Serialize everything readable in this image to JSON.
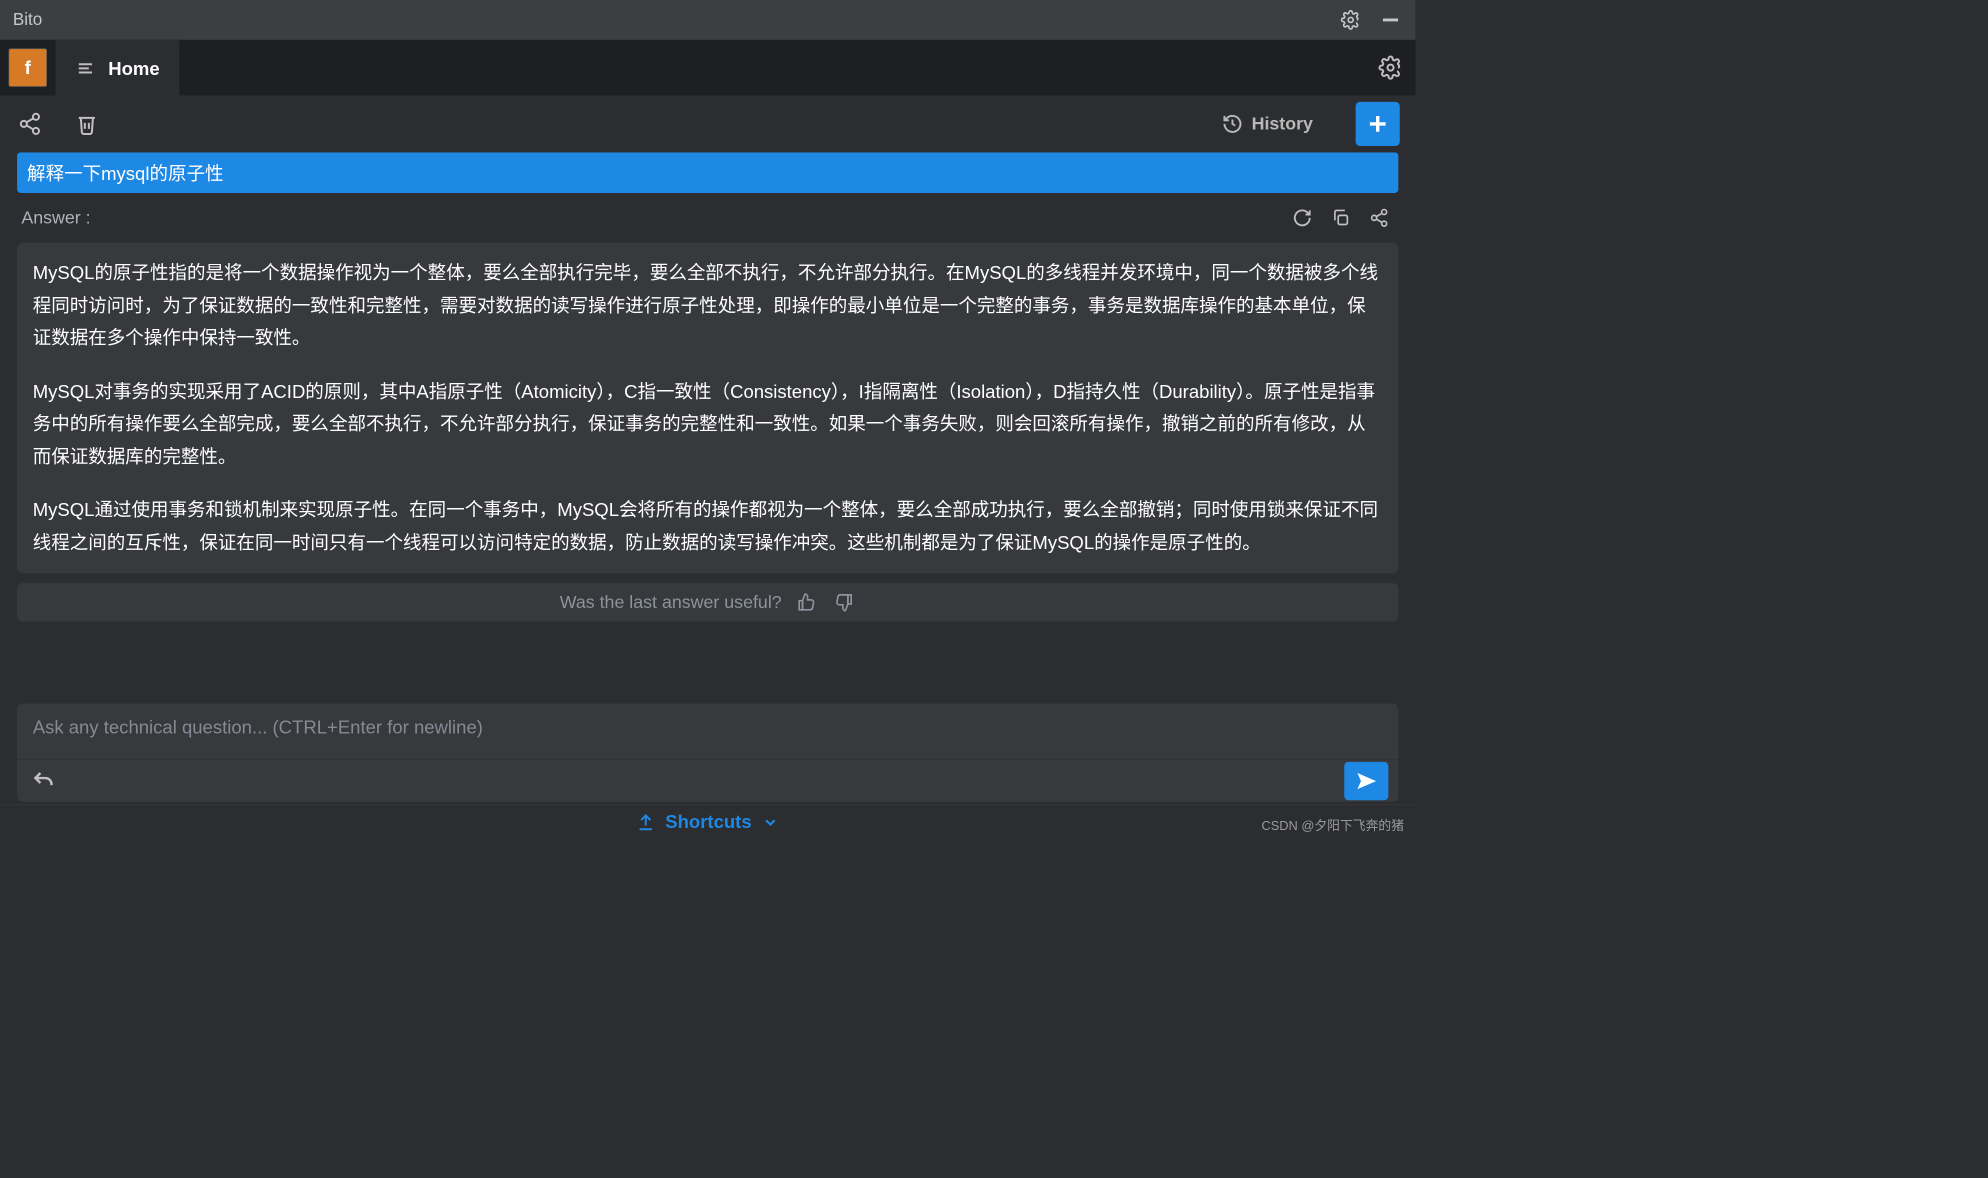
{
  "title": "Bito",
  "avatar_letter": "f",
  "tab_home": "Home",
  "history_label": "History",
  "question": "解释一下mysql的原子性",
  "answer_label": "Answer :",
  "answer_p1": "MySQL的原子性指的是将一个数据操作视为一个整体，要么全部执行完毕，要么全部不执行，不允许部分执行。在MySQL的多线程并发环境中，同一个数据被多个线程同时访问时，为了保证数据的一致性和完整性，需要对数据的读写操作进行原子性处理，即操作的最小单位是一个完整的事务，事务是数据库操作的基本单位，保证数据在多个操作中保持一致性。",
  "answer_p2": "MySQL对事务的实现采用了ACID的原则，其中A指原子性（Atomicity），C指一致性（Consistency），I指隔离性（Isolation），D指持久性（Durability）。原子性是指事务中的所有操作要么全部完成，要么全部不执行，不允许部分执行，保证事务的完整性和一致性。如果一个事务失败，则会回滚所有操作，撤销之前的所有修改，从而保证数据库的完整性。",
  "answer_p3": "MySQL通过使用事务和锁机制来实现原子性。在同一个事务中，MySQL会将所有的操作都视为一个整体，要么全部成功执行，要么全部撤销；同时使用锁来保证不同线程之间的互斥性，保证在同一时间只有一个线程可以访问特定的数据，防止数据的读写操作冲突。这些机制都是为了保证MySQL的操作是原子性的。",
  "feedback_label": "Was the last answer useful?",
  "input_placeholder": "Ask any technical question... (CTRL+Enter for newline)",
  "shortcuts_label": "Shortcuts",
  "footer": "CSDN @夕阳下飞奔的猪"
}
